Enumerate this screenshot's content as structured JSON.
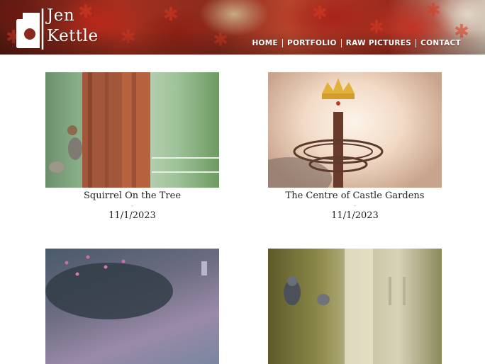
{
  "header": {
    "logo": {
      "line1": "Jen",
      "line2": "Kettle"
    },
    "nav": [
      "HOME",
      "PORTFOLIO",
      "RAW PICTURES",
      "CONTACT"
    ]
  },
  "gallery": [
    {
      "title": "Squirrel On the Tree",
      "dash": "-",
      "date": "11/1/2023"
    },
    {
      "title": "The Centre of Castle Gardens",
      "dash": "-",
      "date": "11/1/2023"
    },
    {
      "title": "",
      "dash": "",
      "date": ""
    },
    {
      "title": "",
      "dash": "",
      "date": ""
    }
  ]
}
